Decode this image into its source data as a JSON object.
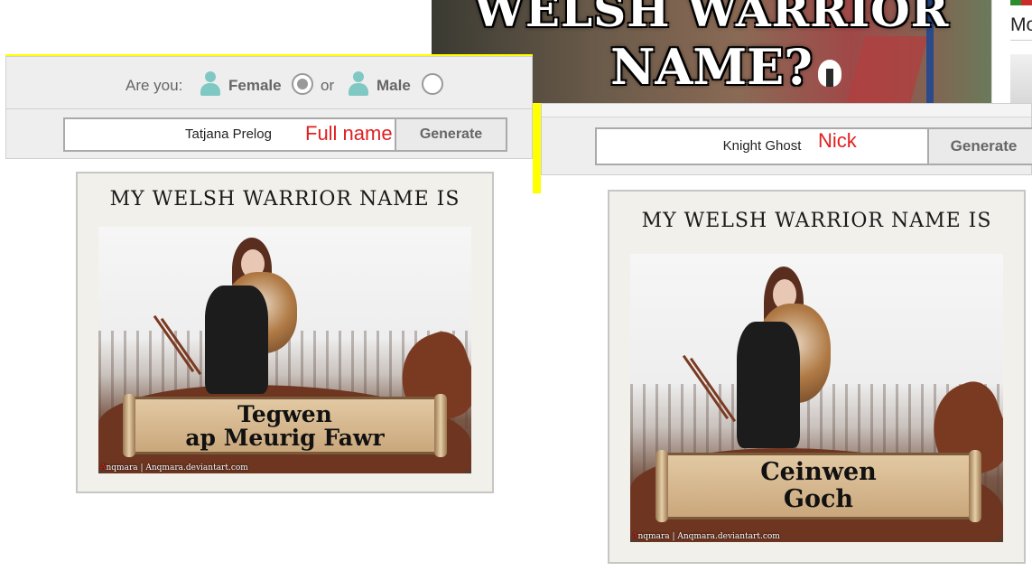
{
  "banner": {
    "line1": "WELSH WARRIOR",
    "line2": "NAME?"
  },
  "side_strip": {
    "text": "Mo"
  },
  "left_form": {
    "gender_prompt": "Are you:",
    "female_label": "Female",
    "or_label": "or",
    "male_label": "Male",
    "female_selected": true,
    "name_value": "Tatjana Prelog",
    "annotation": "Full name",
    "generate_label": "Generate"
  },
  "right_form": {
    "name_value": "Knight Ghost",
    "annotation": "Nick",
    "generate_label": "Generate"
  },
  "left_card": {
    "title": "MY WELSH WARRIOR NAME IS",
    "name_line1": "Tegwen",
    "name_line2": "ap Meurig Fawr",
    "credit_initial": "A",
    "credit_rest": "nqmara | Anqmara.deviantart.com"
  },
  "right_card": {
    "title": "MY WELSH WARRIOR NAME IS",
    "name_line1": "Ceinwen",
    "name_line2": "Goch",
    "credit_initial": "A",
    "credit_rest": "nqmara | Anqmara.deviantart.com"
  },
  "colors": {
    "accent_red": "#e02020",
    "highlight": "#ffff00",
    "icon_teal": "#7fc8c4"
  }
}
